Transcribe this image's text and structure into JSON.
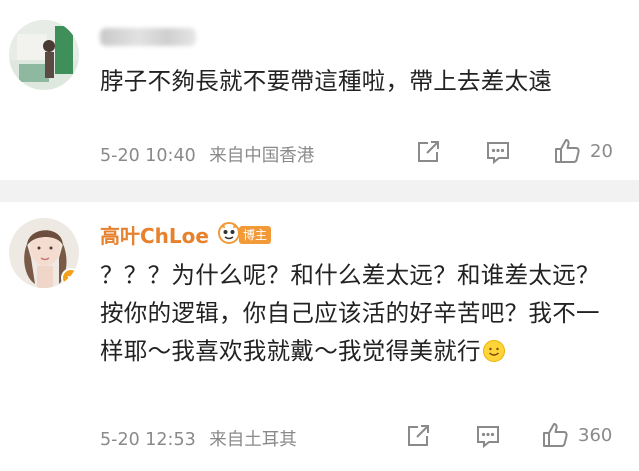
{
  "comments": [
    {
      "username": "",
      "text": "脖子不夠長就不要帶這種啦，帶上去差太遠",
      "time": "5-20 10:40",
      "location": "来自中国香港",
      "likes": "20",
      "avatar_icon": "user-avatar-photo"
    },
    {
      "username": "高叶ChLoe",
      "badge": "博主",
      "text": "？？？为什么呢？和什么差太远？和谁差太远？按你的逻辑，你自己应该活的好辛苦吧？我不一样耶～我喜欢我就戴～我觉得美就行",
      "time": "5-20 12:53",
      "location": "来自土耳其",
      "likes": "360",
      "verified_icon": "v",
      "avatar_icon": "user-avatar-photo",
      "emoji": "smile-emoji"
    }
  ],
  "colors": {
    "username_accent": "#e6812e",
    "badge": "#f29a38",
    "meta_gray": "#8a8a8a",
    "divider": "#f2f2f2"
  }
}
